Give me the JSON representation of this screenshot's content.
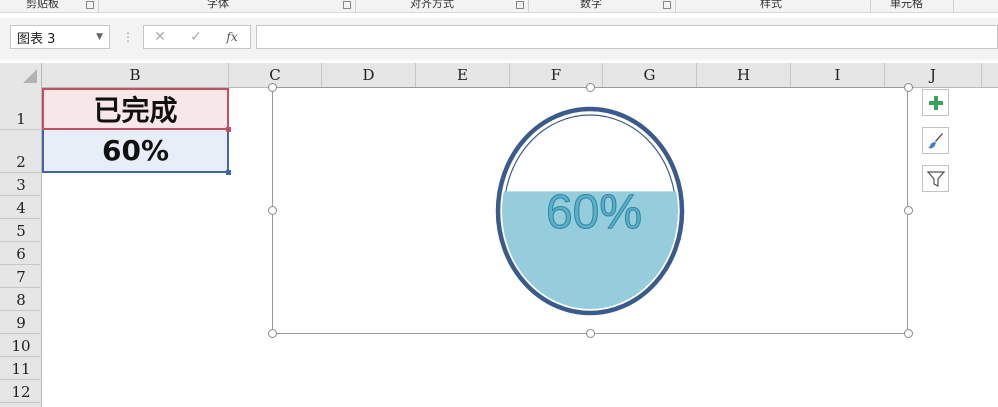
{
  "ribbon": {
    "groups": [
      "剪贴板",
      "字体",
      "对齐方式",
      "数字",
      "样式",
      "单元格"
    ]
  },
  "formula_bar": {
    "name_box": "图表 3",
    "cancel_icon": "✕",
    "enter_icon": "✓",
    "fx_label": "fx",
    "formula": ""
  },
  "columns": [
    "B",
    "C",
    "D",
    "E",
    "F",
    "G",
    "H",
    "I",
    "J"
  ],
  "rows": [
    "1",
    "2",
    "3",
    "4",
    "5",
    "6",
    "7",
    "8",
    "9",
    "10",
    "11",
    "12"
  ],
  "cells": {
    "b1": "已完成",
    "b2": "60%"
  },
  "chart": {
    "label": "60%",
    "fill_fraction": 0.6,
    "colors": {
      "ring": "#3b5b8c",
      "liquid": "#96cddd",
      "label": "#5ab0c8",
      "label_outline": "#2f86a3"
    }
  },
  "chart_tools": [
    "add-chart-element",
    "chart-styles",
    "chart-filters"
  ]
}
